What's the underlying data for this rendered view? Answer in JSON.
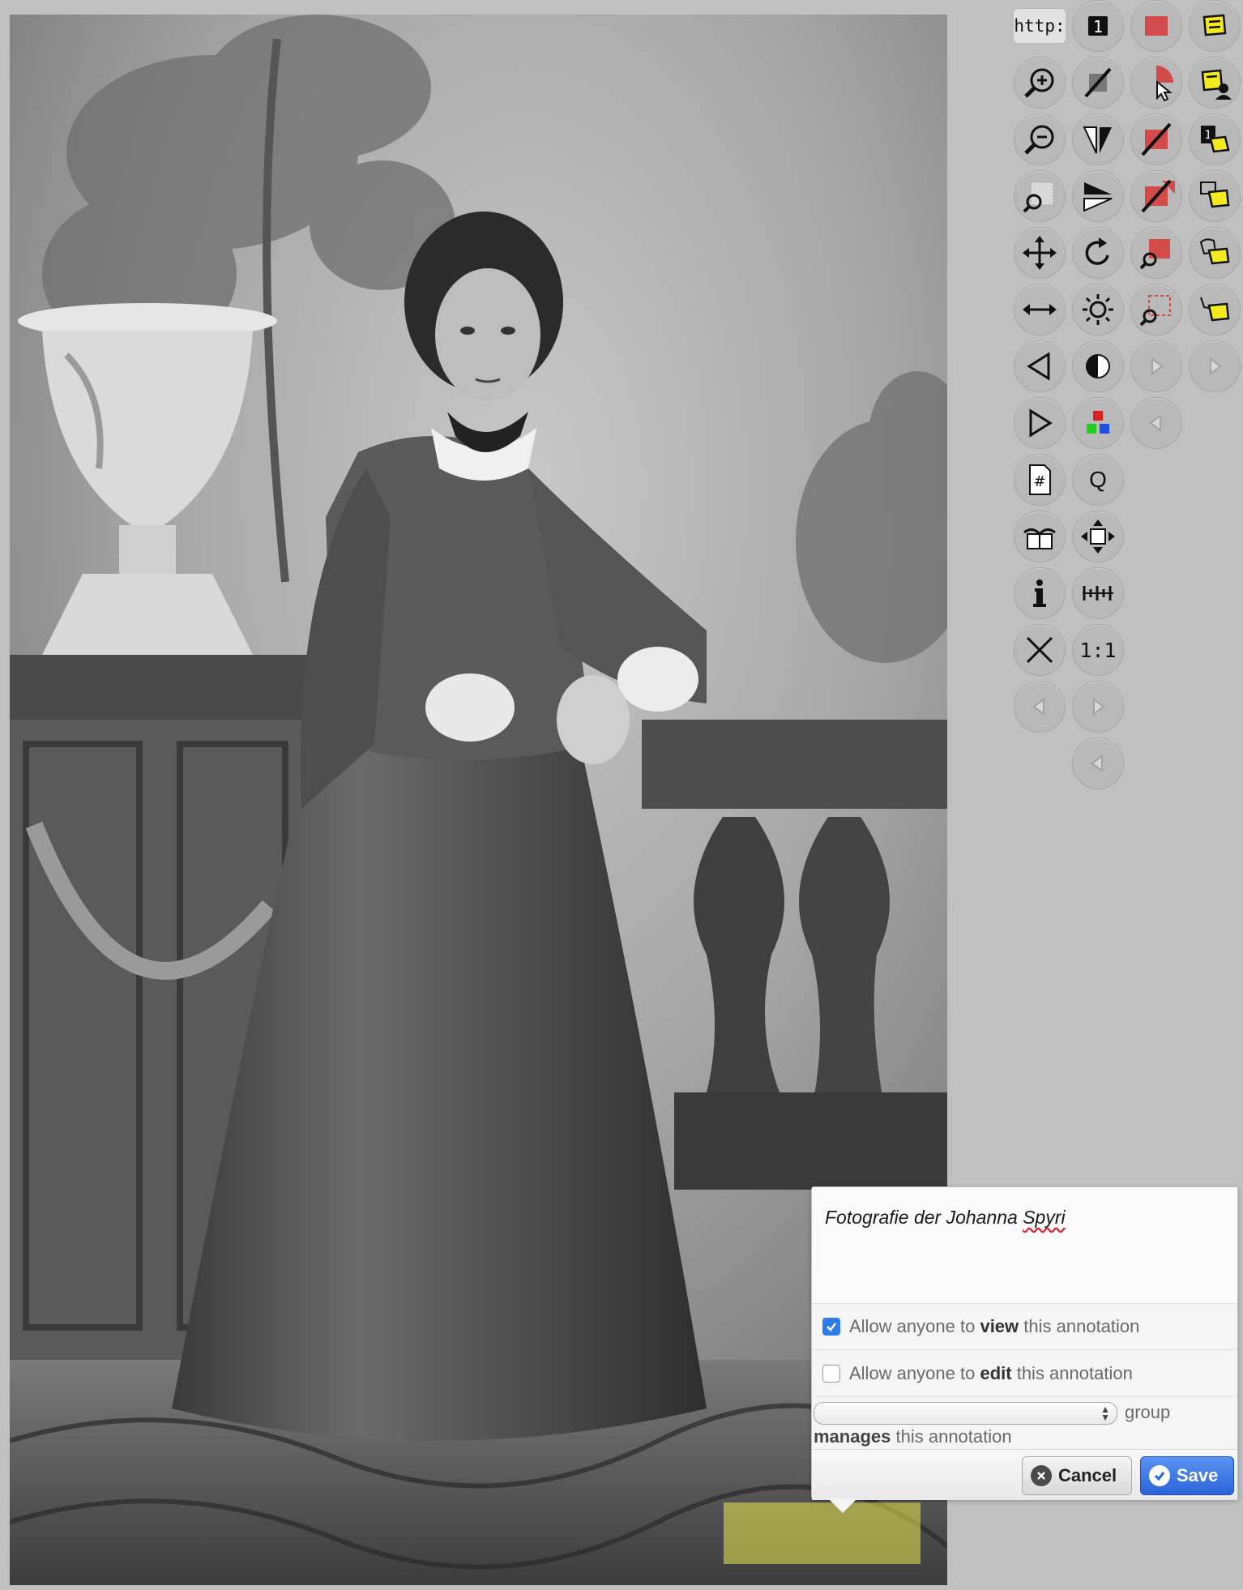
{
  "toolbar": {
    "http_label": "http:",
    "ratio_label": "1:1",
    "quality_label": "Q",
    "page_label": "#",
    "buttons": [
      "page-1",
      "hide-annotations",
      "annotate-rectangle",
      "annotations-list",
      "zoom-in",
      "page-hide",
      "select-region-pointer",
      "user-annotations",
      "zoom-out",
      "mirror-vertical",
      "delete-annotation",
      "page-annotation",
      "zoom-window",
      "mirror-horizontal",
      "delete-annotation-partial",
      "comment-annotation",
      "pan",
      "rotate",
      "zoom-annotation",
      "comment-annotation-2",
      "fit-width",
      "brightness",
      "zoom-selection",
      "reply-annotation",
      "previous-page",
      "contrast",
      "next-disabled",
      "next-disabled-2",
      "next-page",
      "rgb",
      "previous-disabled",
      "page-number",
      "quality",
      "book-mode",
      "scroll",
      "info",
      "measure",
      "close",
      "original-size",
      "back-disabled",
      "forward-disabled",
      "back-disabled-2"
    ]
  },
  "annotation_editor": {
    "text_part1": "Fotografie der Johanna ",
    "text_part2": "Spyri",
    "view_permission": {
      "prefix": "Allow anyone to ",
      "bold": "view",
      "suffix": " this annotation",
      "checked": true
    },
    "edit_permission": {
      "prefix": "Allow anyone to ",
      "bold": "edit",
      "suffix": " this annotation",
      "checked": false
    },
    "group_select_value": "",
    "group_suffix": "group",
    "group_line2_bold": "manages",
    "group_line2_rest": " this annotation",
    "cancel_label": "Cancel",
    "save_label": "Save"
  },
  "colors": {
    "toolbar_button": "#b9b9b9",
    "annotation_red": "#d24a4a",
    "annotation_yellow": "#f3ea1e",
    "save_blue": "#2a63d8",
    "highlight": "#e8e850"
  }
}
